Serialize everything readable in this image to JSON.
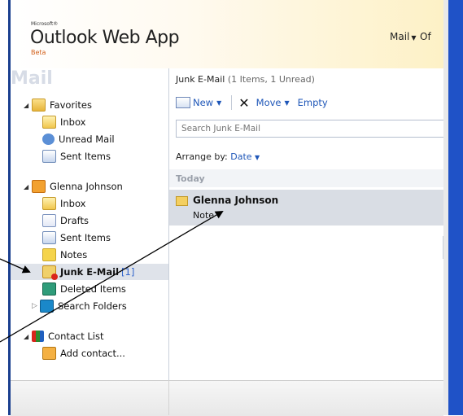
{
  "header": {
    "brand_small": "Microsoft®",
    "app_title": "Outlook Web App",
    "beta": "Beta",
    "mail_menu": "Mail",
    "other_menu": "Of"
  },
  "nav": {
    "title": "Mail",
    "favorites": {
      "label": "Favorites",
      "items": [
        {
          "label": "Inbox",
          "icon": "inbox-icon"
        },
        {
          "label": "Unread Mail",
          "icon": "unread-mail-icon"
        },
        {
          "label": "Sent Items",
          "icon": "sent-items-icon"
        }
      ]
    },
    "mailbox": {
      "label": "Glenna Johnson",
      "items": [
        {
          "label": "Inbox",
          "icon": "inbox-icon"
        },
        {
          "label": "Drafts",
          "icon": "drafts-icon"
        },
        {
          "label": "Sent Items",
          "icon": "sent-items-icon"
        },
        {
          "label": "Notes",
          "icon": "notes-icon"
        },
        {
          "label": "Junk E-Mail",
          "count": "[1]",
          "icon": "junk-email-icon",
          "selected": true
        },
        {
          "label": "Deleted Items",
          "icon": "deleted-items-icon"
        },
        {
          "label": "Search Folders",
          "icon": "search-folders-icon"
        }
      ]
    },
    "contacts": {
      "label": "Contact List",
      "add_contact": "Add contact..."
    }
  },
  "content": {
    "folder_name": "Junk E-Mail",
    "folder_counts": "(1 Items, 1 Unread)",
    "toolbar": {
      "new_label": "New",
      "move_label": "Move",
      "empty_label": "Empty"
    },
    "search_placeholder": "Search Junk E-Mail",
    "arrange_label": "Arrange by:",
    "arrange_value": "Date",
    "group_label": "Today",
    "messages": [
      {
        "from": "Glenna Johnson",
        "subject": "Note"
      }
    ]
  },
  "colors": {
    "accent": "#1e56b8",
    "selection": "#dfe3ea",
    "window_border": "#1f52c7"
  }
}
